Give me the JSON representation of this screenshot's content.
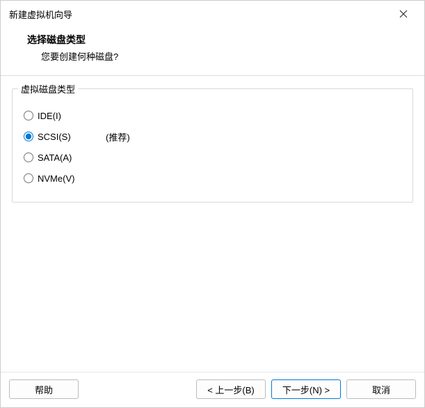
{
  "window": {
    "title": "新建虚拟机向导"
  },
  "header": {
    "title": "选择磁盘类型",
    "subtitle": "您要创建何种磁盘?"
  },
  "group": {
    "legend": "虚拟磁盘类型",
    "options": {
      "ide": "IDE(I)",
      "scsi": "SCSI(S)",
      "sata": "SATA(A)",
      "nvme": "NVMe(V)"
    },
    "recommended": "(推荐)"
  },
  "buttons": {
    "help": "帮助",
    "back": "< 上一步(B)",
    "next": "下一步(N) >",
    "cancel": "取消"
  }
}
